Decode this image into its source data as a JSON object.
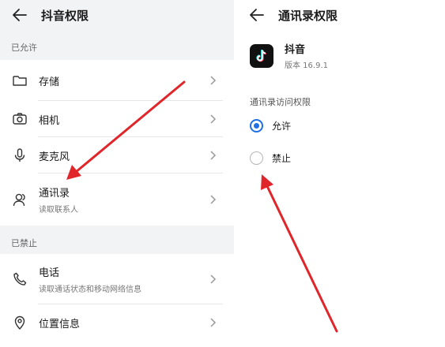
{
  "left": {
    "title": "抖音权限",
    "allowed_label": "已允许",
    "denied_label": "已禁止",
    "allowed_items": [
      {
        "name": "存储",
        "icon": "folder-icon"
      },
      {
        "name": "相机",
        "icon": "camera-icon"
      },
      {
        "name": "麦克风",
        "icon": "microphone-icon"
      },
      {
        "name": "通讯录",
        "sub": "读取联系人",
        "icon": "contacts-icon"
      }
    ],
    "denied_items": [
      {
        "name": "电话",
        "sub": "读取通话状态和移动网络信息",
        "icon": "phone-icon"
      },
      {
        "name": "位置信息",
        "icon": "location-icon"
      }
    ]
  },
  "right": {
    "title": "通讯录权限",
    "app_name": "抖音",
    "app_version": "版本 16.9.1",
    "permission_label": "通讯录访问权限",
    "options": [
      {
        "label": "允许",
        "selected": true
      },
      {
        "label": "禁止",
        "selected": false
      }
    ]
  },
  "colors": {
    "accent": "#1f6fe5",
    "arrow": "#e0262a"
  }
}
